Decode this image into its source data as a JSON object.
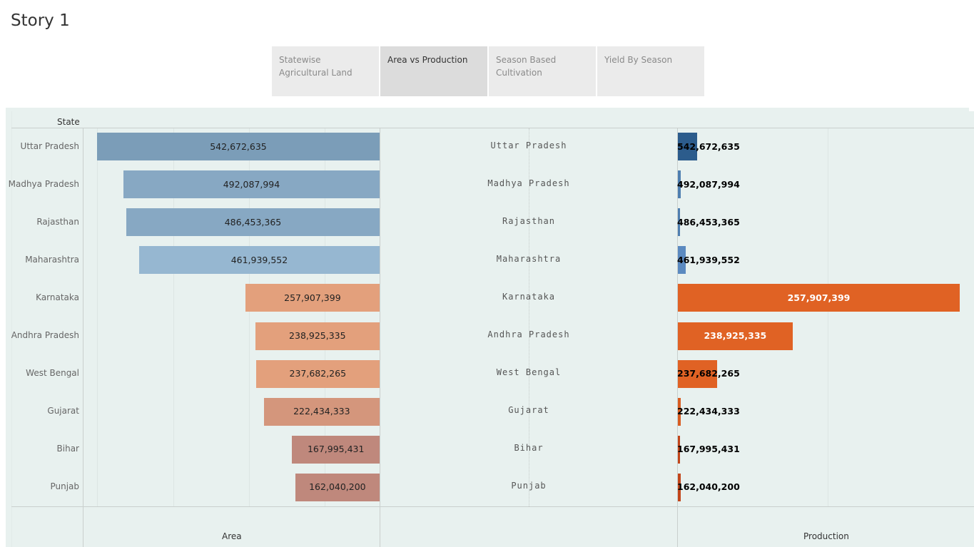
{
  "story_title": "Story 1",
  "tabs": [
    {
      "label": "Statewise Agricultural Land",
      "active": false
    },
    {
      "label": "Area vs Production",
      "active": true
    },
    {
      "label": "Season Based Cultivation",
      "active": false
    },
    {
      "label": "Yield By Season",
      "active": false
    }
  ],
  "viz": {
    "state_header": "State",
    "area_axis_title": "Area",
    "production_axis_title": "Production"
  },
  "chart_data": {
    "type": "bar",
    "categories": [
      "Uttar Pradesh",
      "Madhya Pradesh",
      "Rajasthan",
      "Maharashtra",
      "Karnataka",
      "Andhra Pradesh",
      "West Bengal",
      "Gujarat",
      "Bihar",
      "Punjab"
    ],
    "series": [
      {
        "name": "Area",
        "values": [
          542672635,
          492087994,
          486453365,
          461939552,
          257907399,
          238925335,
          237682265,
          222434333,
          167995431,
          162040200
        ],
        "labels": [
          "542,672,635",
          "492,087,994",
          "486,453,365",
          "461,939,552",
          "257,907,399",
          "238,925,335",
          "237,682,265",
          "222,434,333",
          "167,995,431",
          "162,040,200"
        ],
        "colors": [
          "#7b9db8",
          "#87a8c3",
          "#87a8c3",
          "#96b7d1",
          "#e3a07c",
          "#e3a07c",
          "#e3a07c",
          "#d4967c",
          "#bf887c",
          "#bf887c"
        ]
      },
      {
        "name": "Production",
        "values": [
          0.068,
          0.009,
          0.008,
          0.027,
          1.0,
          0.407,
          0.14,
          0.011,
          0.005,
          0.011
        ],
        "labels": [
          "542,672,635",
          "492,087,994",
          "486,453,365",
          "461,939,552",
          "257,907,399",
          "238,925,335",
          "237,682,265",
          "222,434,333",
          "167,995,431",
          "162,040,200"
        ],
        "colors": [
          "#2c5c8c",
          "#4f7fb0",
          "#4f7fb0",
          "#5b8ac0",
          "#e06224",
          "#e06224",
          "#e06224",
          "#d85d22",
          "#c2461b",
          "#c2461b"
        ],
        "label_colors": [
          "#000000",
          "#000000",
          "#000000",
          "#000000",
          "#ffffff",
          "#ffffff",
          "#000000",
          "#000000",
          "#000000",
          "#000000"
        ]
      }
    ],
    "area_xlim": [
      0,
      600000000
    ],
    "grid": true
  }
}
